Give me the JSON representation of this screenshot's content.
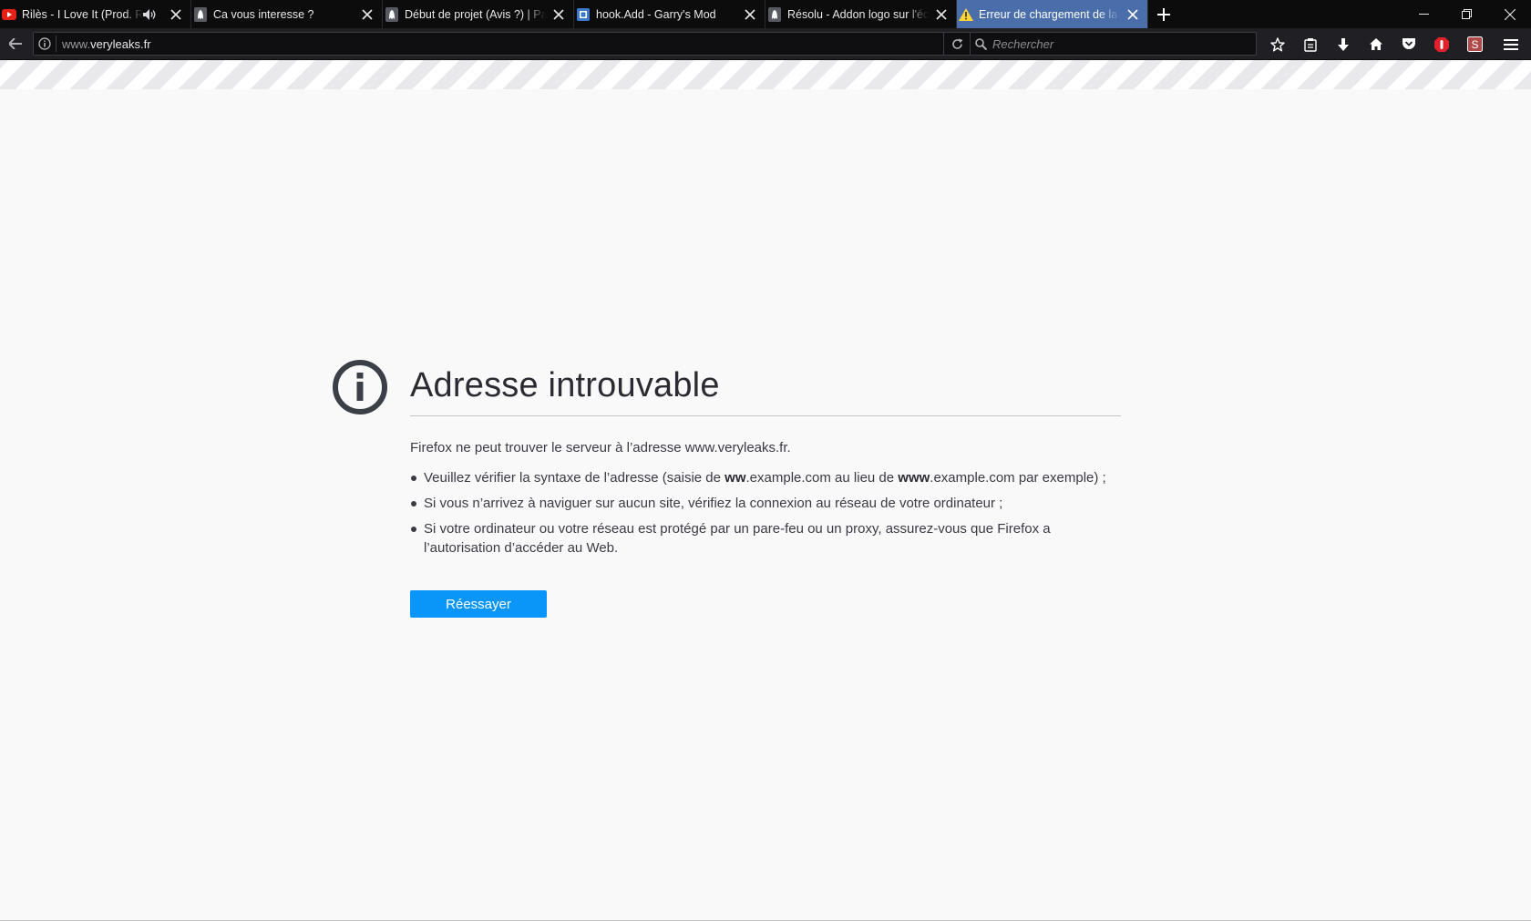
{
  "colors": {
    "tabstrip_bg": "#0c0c0d",
    "active_tab": "#4a6ea9",
    "navbar_bg": "#202024",
    "page_bg": "#f9f9fa",
    "retry_button": "#0996f8"
  },
  "tabs": [
    {
      "title": "Rilès - I Love It (Prod. Rilès)",
      "icon": "youtube-icon",
      "audio": true,
      "active": false
    },
    {
      "title": "Ca vous interesse ?",
      "icon": "forum-ghost-icon",
      "audio": false,
      "active": false
    },
    {
      "title": "Début de projet (Avis ?) | Page",
      "icon": "forum-ghost-icon",
      "audio": false,
      "active": false
    },
    {
      "title": "hook.Add - Garry's Mod",
      "icon": "wiki-icon",
      "audio": false,
      "active": false
    },
    {
      "title": "Résolu - Addon logo sur l'écran",
      "icon": "forum-ghost-icon",
      "audio": false,
      "active": false
    },
    {
      "title": "Erreur de chargement de la page",
      "icon": "warning-icon",
      "audio": false,
      "active": true
    }
  ],
  "navbar": {
    "url_prefix": "www.",
    "url_domain": "veryleaks.fr",
    "search_placeholder": "Rechercher"
  },
  "error_page": {
    "title": "Adresse introuvable",
    "description": "Firefox ne peut trouver le serveur à l’adresse www.veryleaks.fr.",
    "bullet1_before": "Veuillez vérifier la syntaxe de l’adresse (saisie de ",
    "bullet1_bold1": "ww",
    "bullet1_mid": ".example.com au lieu de ",
    "bullet1_bold2": "www",
    "bullet1_after": ".example.com par exemple) ;",
    "bullet2": "Si vous n’arrivez à naviguer sur aucun site, vérifiez la connexion au réseau de votre ordinateur ;",
    "bullet3": "Si votre ordinateur ou votre réseau est protégé par un pare-feu ou un proxy, assurez-vous que Firefox a l’autorisation d’accéder au Web.",
    "retry_label": "Réessayer"
  }
}
